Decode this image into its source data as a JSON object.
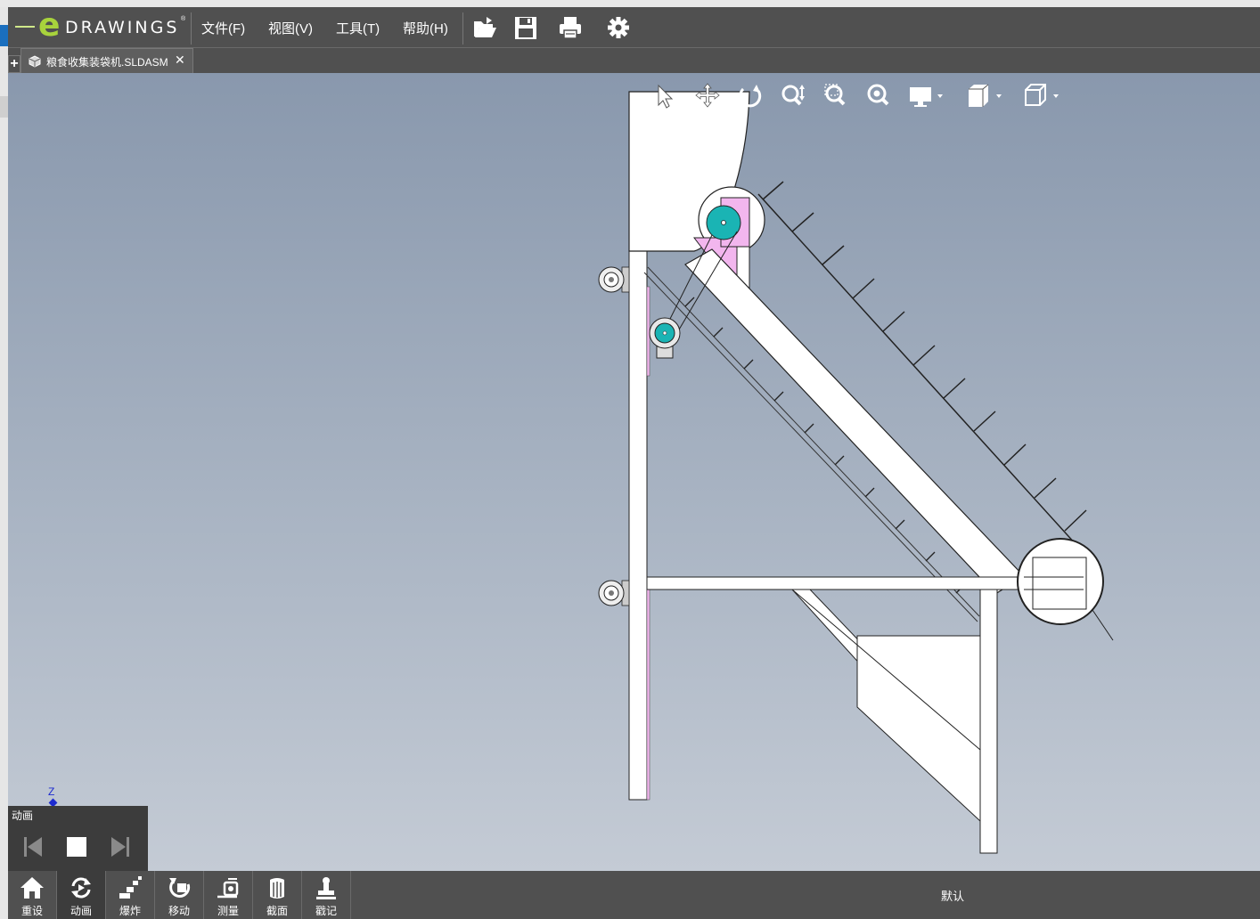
{
  "app": {
    "logo_text": "DRAWINGS",
    "logo_letter": "e",
    "logo_reg": "®"
  },
  "menu": {
    "file": "文件(F)",
    "view": "视图(V)",
    "tools": "工具(T)",
    "help": "帮助(H)"
  },
  "toolbar": [
    "folder-open-icon",
    "save-icon",
    "print-icon",
    "settings-gear-icon"
  ],
  "tabs": {
    "new_tab": "+",
    "document_name": "粮食收集装袋机.SLDASM",
    "close": "✕"
  },
  "view_tools": [
    "select-arrow-icon",
    "pan-icon",
    "rotate-icon",
    "zoom-icon",
    "zoom-area-icon",
    "zoom-fit-icon",
    "display-icon",
    "view-style-icon",
    "view-orientation-icon"
  ],
  "axis": {
    "z_label": "Z"
  },
  "animation_panel": {
    "title": "动画",
    "controls": [
      "previous-icon",
      "stop-icon",
      "next-icon"
    ]
  },
  "bottom_tools": [
    {
      "label": "重设",
      "icon": "home-icon",
      "active": false
    },
    {
      "label": "动画",
      "icon": "animate-icon",
      "active": true
    },
    {
      "label": "爆炸",
      "icon": "explode-icon",
      "active": false
    },
    {
      "label": "移动",
      "icon": "move-icon",
      "active": false
    },
    {
      "label": "测量",
      "icon": "measure-icon",
      "active": false
    },
    {
      "label": "截面",
      "icon": "section-icon",
      "active": false
    },
    {
      "label": "戳记",
      "icon": "stamp-icon",
      "active": false
    }
  ],
  "status": {
    "configuration": "默认"
  },
  "colors": {
    "accent_green": "#a8d33c",
    "bar": "#505050",
    "belt_hub": "#1ab4b4",
    "plate_pink": "#f2b6ee"
  }
}
